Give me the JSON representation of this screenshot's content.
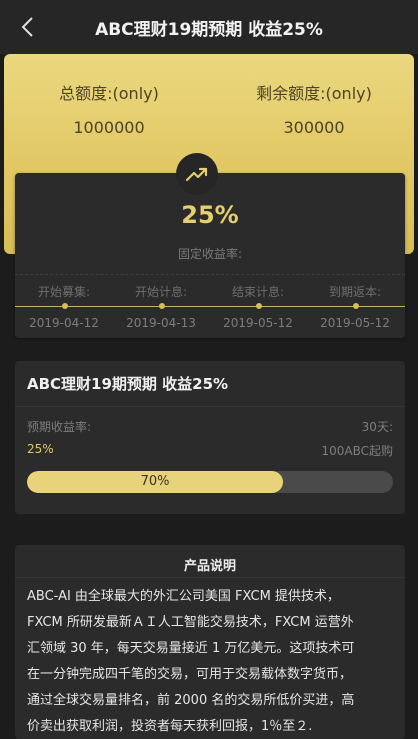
{
  "header": {
    "title": "ABC理财19期预期 收益25%",
    "back_icon": "chevron-left-icon"
  },
  "quota": {
    "total_label": "总额度:(only)",
    "total_value": "1000000",
    "remaining_label": "剩余额度:(only)",
    "remaining_value": "300000"
  },
  "rate": {
    "icon": "trending-up-icon",
    "value": "25%",
    "label": "固定收益率:"
  },
  "timeline": [
    {
      "label": "开始募集:",
      "date": "2019-04-12"
    },
    {
      "label": "开始计息:",
      "date": "2019-04-13"
    },
    {
      "label": "结束计息:",
      "date": "2019-05-12"
    },
    {
      "label": "到期返本:",
      "date": "2019-05-12"
    }
  ],
  "product": {
    "title": "ABC理财19期预期 收益25%",
    "expected_rate_label": "预期收益率:",
    "duration": "30天:",
    "expected_rate_value": "25%",
    "min_invest": "100ABC起购",
    "progress_percent": 70,
    "progress_text": "70%"
  },
  "description": {
    "title": "产品说明",
    "lines": [
      "ABC-AI 由全球最大的外汇公司美国 FXCM 提供技术，",
      "FXCM 所研发最新ＡＩ人工智能交易技术，FXCM 运营外",
      "汇领域 30 年，每天交易量接近 1 万亿美元。这项技术可",
      "在一分钟完成四千笔的交易，可用于交易载体数字货币，",
      "通过全球交易量排名，前 2000 名的交易所低价买进，高",
      "价卖出获取利润，投资者每天获利回报，1％至２."
    ]
  },
  "colors": {
    "gold": "#e2c865",
    "background": "#1c1c1c",
    "card": "#2b2b2b"
  }
}
